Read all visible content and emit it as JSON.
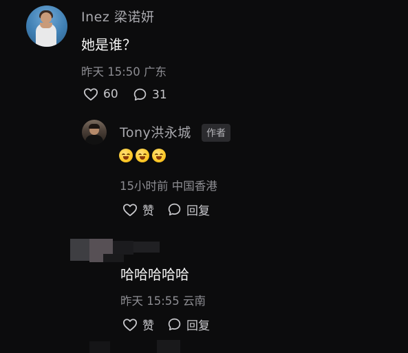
{
  "comment_main": {
    "username": "Inez 梁诺妍",
    "text": "她是谁？",
    "meta": "昨天 15:50 广东",
    "like_count": "60",
    "reply_count": "31"
  },
  "reply_author": {
    "username": "Tony洪永城",
    "badge": "作者",
    "meta": "15小时前 中国香港",
    "like_label": "赞",
    "reply_label": "回复",
    "emoji_count": 3,
    "emoji_name": "laughing-face"
  },
  "reply_second": {
    "text": "哈哈哈哈哈",
    "meta": "昨天 15:55 云南",
    "like_label": "赞",
    "reply_label": "回复"
  },
  "colors": {
    "background": "#0c0c0d",
    "text_primary": "#f4f4f4",
    "text_secondary": "#8d8d92",
    "username": "#a8a8ad"
  }
}
